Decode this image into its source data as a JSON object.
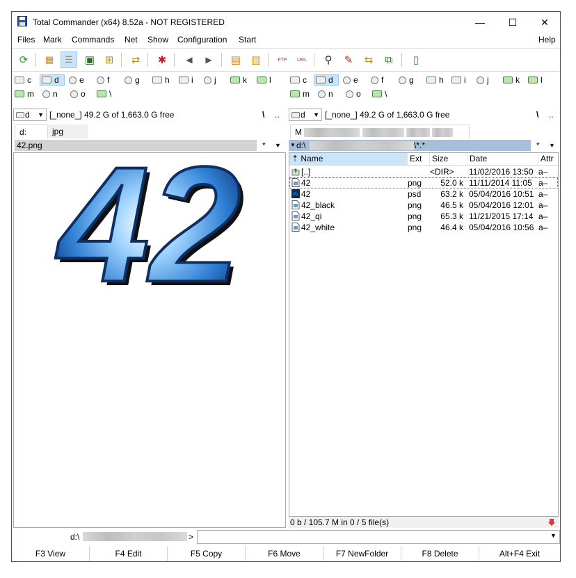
{
  "window": {
    "title": "Total Commander (x64) 8.52a - NOT REGISTERED",
    "controls": {
      "minimize": "—",
      "maximize": "☐",
      "close": "✕"
    }
  },
  "menu": {
    "items": [
      "Files",
      "Mark",
      "Commands",
      "Net",
      "Show",
      "Configuration",
      "Start"
    ],
    "help": "Help"
  },
  "toolbar": {
    "buttons": [
      {
        "icon": "refresh-icon",
        "glyph": "⟳"
      },
      {
        "icon": "brief-view-icon",
        "glyph": "▦"
      },
      {
        "icon": "full-view-icon",
        "glyph": "☰"
      },
      {
        "icon": "thumbnails-view-icon",
        "glyph": "▣"
      },
      {
        "icon": "tree-view-icon",
        "glyph": "⊞"
      },
      {
        "icon": "invert-selection-icon",
        "glyph": "⇄"
      },
      {
        "icon": "new-file-icon",
        "glyph": "✱"
      },
      {
        "icon": "back-arrow-icon",
        "glyph": "◀"
      },
      {
        "icon": "forward-arrow-icon",
        "glyph": "▶"
      },
      {
        "icon": "pack-files-icon",
        "glyph": "▤"
      },
      {
        "icon": "unpack-files-icon",
        "glyph": "▥"
      },
      {
        "icon": "ftp-connect-icon",
        "glyph": "FTP"
      },
      {
        "icon": "url-connect-icon",
        "glyph": "URL"
      },
      {
        "icon": "search-binoculars-icon",
        "glyph": "⚲"
      },
      {
        "icon": "multi-rename-icon",
        "glyph": "✎"
      },
      {
        "icon": "sync-dirs-icon",
        "glyph": "⇆"
      },
      {
        "icon": "compare-files-icon",
        "glyph": "⧉"
      },
      {
        "icon": "notepad-icon",
        "glyph": "▯"
      }
    ]
  },
  "drives": {
    "row1": [
      "c",
      "d",
      "e",
      "f",
      "g",
      "h",
      "i",
      "j",
      "k",
      "l"
    ],
    "row2": [
      "m",
      "n",
      "o",
      "\\"
    ]
  },
  "left": {
    "drive_combo": "d",
    "drive_info": "[_none_]  49.2 G of  1,663.0 G free",
    "root_btn": "\\",
    "up_btn": "..",
    "tabs": [
      "d:",
      "jpg"
    ],
    "header_path": "42.png",
    "filter": "*",
    "preview_text": "42"
  },
  "right": {
    "drive_combo": "d",
    "drive_info": "[_none_]  49.2 G of  1,663.0 G free",
    "root_btn": "\\",
    "up_btn": "..",
    "tab_prefix": "M",
    "header_prefix": "d:\\",
    "header_suffix": "\\*.*",
    "filter": "*",
    "columns": {
      "name": "Name",
      "ext": "Ext",
      "size": "Size",
      "date": "Date",
      "attr": "Attr"
    },
    "sort_indicator": "⇡",
    "files": [
      {
        "name": "[..]",
        "ext": "",
        "size": "<DIR>",
        "date": "11/02/2016 13:50",
        "attr": "a–",
        "icon": "folder-up-icon"
      },
      {
        "name": "42",
        "ext": "png",
        "size": "52.0 k",
        "date": "11/11/2014 11:05",
        "attr": "a–",
        "icon": "png-file-icon"
      },
      {
        "name": "42",
        "ext": "psd",
        "size": "63.2 k",
        "date": "05/04/2016 10:51",
        "attr": "a–",
        "icon": "psd-file-icon"
      },
      {
        "name": "42_black",
        "ext": "png",
        "size": "46.5 k",
        "date": "05/04/2016 12:01",
        "attr": "a–",
        "icon": "png-file-icon"
      },
      {
        "name": "42_qi",
        "ext": "png",
        "size": "65.3 k",
        "date": "11/21/2015 17:14",
        "attr": "a–",
        "icon": "png-file-icon"
      },
      {
        "name": "42_white",
        "ext": "png",
        "size": "46.4 k",
        "date": "05/04/2016 10:56",
        "attr": "a–",
        "icon": "png-file-icon"
      }
    ],
    "status": "0 b / 105.7 M in 0 / 5 file(s)"
  },
  "command_line": {
    "prompt_prefix": "d:\\",
    "prompt_suffix": ">",
    "value": ""
  },
  "function_keys": [
    "F3 View",
    "F4 Edit",
    "F5 Copy",
    "F6 Move",
    "F7 NewFolder",
    "F8 Delete",
    "Alt+F4 Exit"
  ],
  "colors": {
    "accent": "#2b579a",
    "header_inactive": "#d3d3d3",
    "header_active": "#a8bfdc",
    "selection": "#cce4f7",
    "preview_blue": "#2f7fd4"
  }
}
